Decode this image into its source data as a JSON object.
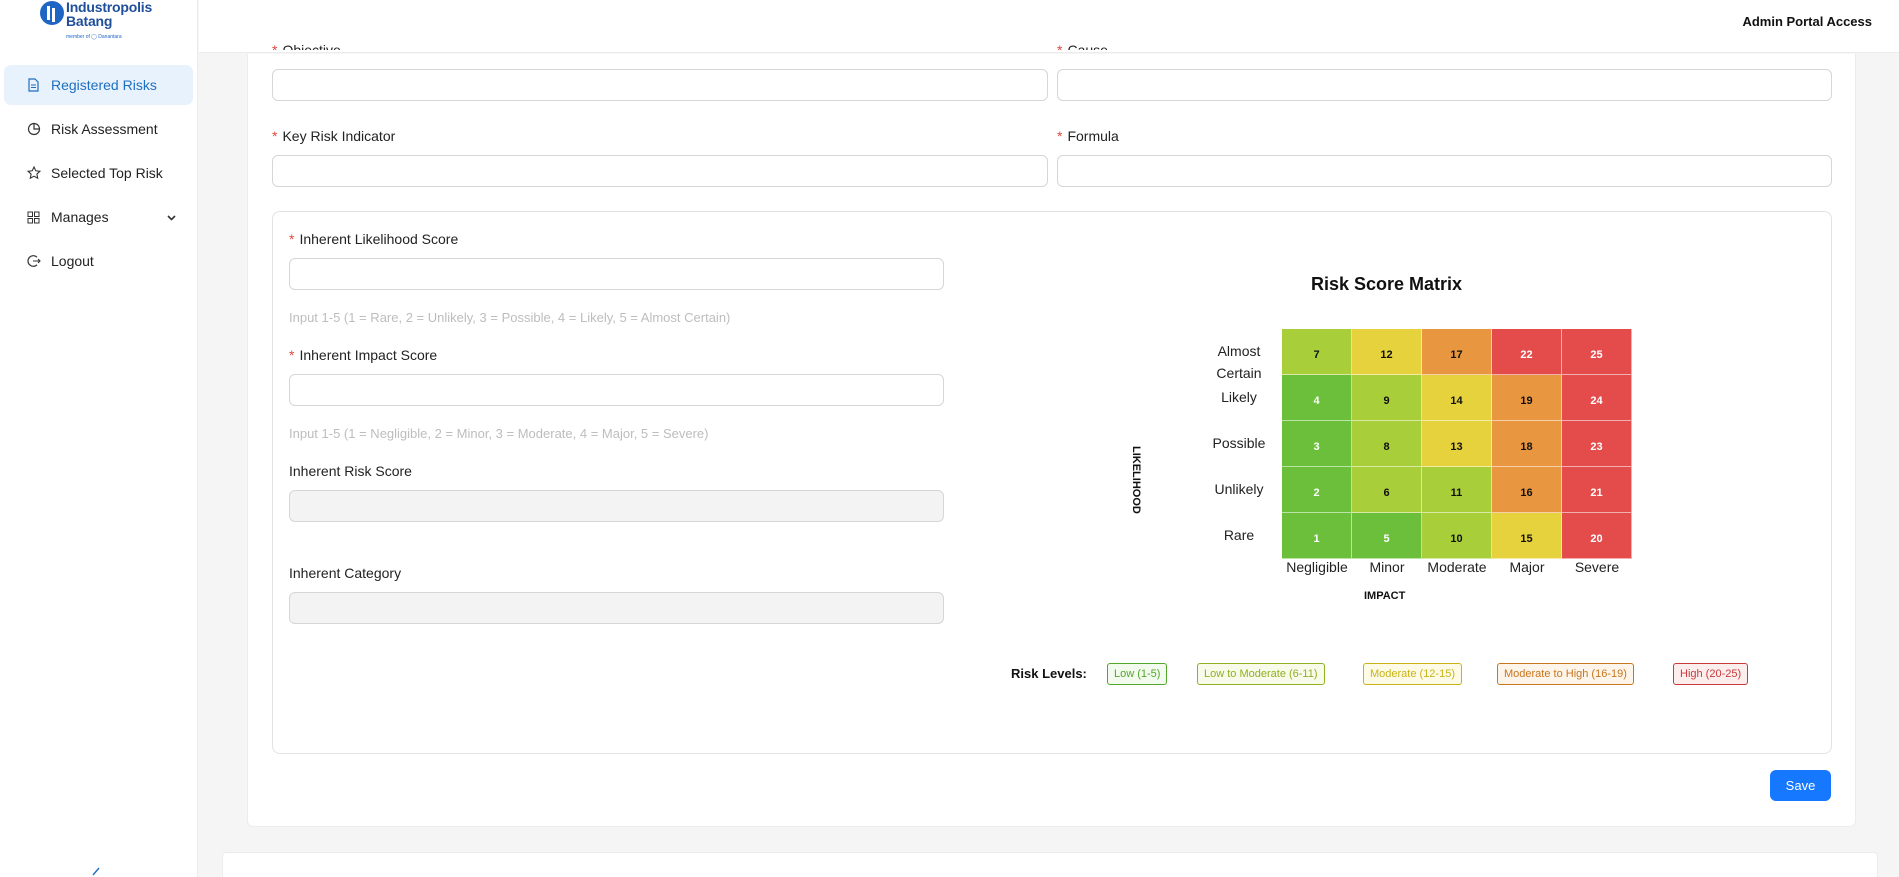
{
  "brand": {
    "name_line1": "Industropolis",
    "name_line2": "Batang",
    "subtitle": "member of ◯ Danantara"
  },
  "header": {
    "title": "Admin Portal Access"
  },
  "sidebar": {
    "items": [
      {
        "label": "Registered Risks",
        "icon": "file-icon",
        "active": true
      },
      {
        "label": "Risk Assessment",
        "icon": "chart-pie-icon"
      },
      {
        "label": "Selected Top Risk",
        "icon": "star-icon"
      },
      {
        "label": "Manages",
        "icon": "grid-icon",
        "has_children": true
      },
      {
        "label": "Logout",
        "icon": "logout-icon"
      }
    ]
  },
  "form": {
    "objective_label": "Objective",
    "cause_label": "Cause",
    "kri_label": "Key Risk Indicator",
    "formula_label": "Formula",
    "likelihood_label": "Inherent Likelihood Score",
    "likelihood_hint": "Input 1-5 (1 = Rare, 2 = Unlikely, 3 = Possible, 4 = Likely, 5 = Almost Certain)",
    "impact_label": "Inherent Impact Score",
    "impact_hint": "Input 1-5 (1 = Negligible, 2 = Minor, 3 = Moderate, 4 = Major, 5 = Severe)",
    "risk_score_label": "Inherent Risk Score",
    "category_label": "Inherent Category",
    "required_mark": "*",
    "save_label": "Save"
  },
  "matrix": {
    "title": "Risk Score Matrix",
    "y_axis_label": "LIKELIHOOD",
    "x_axis_label": "IMPACT",
    "likelihood_levels": [
      "Almost Certain",
      "Likely",
      "Possible",
      "Unlikely",
      "Rare"
    ],
    "impact_levels": [
      "Negligible",
      "Minor",
      "Moderate",
      "Major",
      "Severe"
    ],
    "rows": [
      [
        7,
        12,
        17,
        22,
        25
      ],
      [
        4,
        9,
        14,
        19,
        24
      ],
      [
        3,
        8,
        13,
        18,
        23
      ],
      [
        2,
        6,
        11,
        16,
        21
      ],
      [
        1,
        5,
        10,
        15,
        20
      ]
    ],
    "colors": {
      "low": "#6bbf3a",
      "low_moderate": "#a8cf3a",
      "moderate": "#e6d23c",
      "moderate_high": "#e99640",
      "high": "#e44c4c"
    }
  },
  "legend": {
    "label": "Risk Levels:",
    "levels": [
      {
        "label": "Low (1-5)",
        "color": "#52a82a",
        "bg": "#f3faee"
      },
      {
        "label": "Low to Moderate (6-11)",
        "color": "#8fb021",
        "bg": "#f8fbe9"
      },
      {
        "label": "Moderate (12-15)",
        "color": "#c9b318",
        "bg": "#fdfbe6"
      },
      {
        "label": "Moderate to High (16-19)",
        "color": "#c9761e",
        "bg": "#fdf4ea"
      },
      {
        "label": "High (20-25)",
        "color": "#c93a3a",
        "bg": "#fdeeee"
      }
    ]
  }
}
